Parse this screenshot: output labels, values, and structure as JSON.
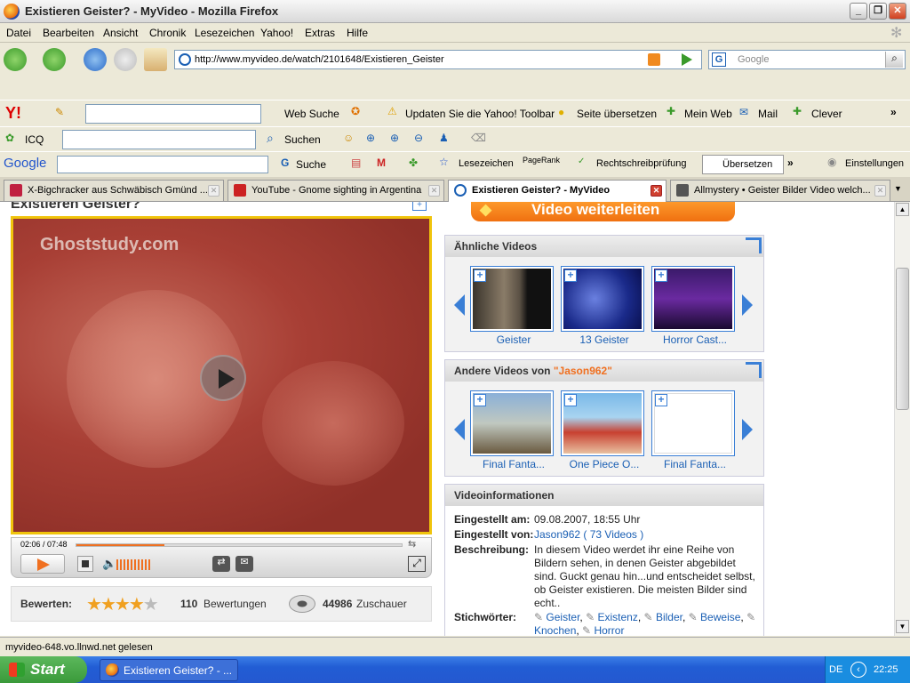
{
  "window": {
    "title": "Existieren Geister? - MyVideo - Mozilla Firefox"
  },
  "menu": [
    "Datei",
    "Bearbeiten",
    "Ansicht",
    "Chronik",
    "Lesezeichen",
    "Yahoo!",
    "Extras",
    "Hilfe"
  ],
  "nav": {
    "url": "http://www.myvideo.de/watch/2101648/Existieren_Geister",
    "search_placeholder": "Google"
  },
  "yahoo_toolbar": {
    "web_search": "Web Suche",
    "update": "Updaten Sie die Yahoo! Toolbar",
    "translate": "Seite übersetzen",
    "my_web": "Mein Web",
    "mail": "Mail",
    "clever": "Clever"
  },
  "icq_toolbar": {
    "label": "ICQ",
    "search": "Suchen"
  },
  "google_toolbar": {
    "search": "Suche",
    "bookmarks": "Lesezeichen",
    "pagerank": "PageRank",
    "spell": "Rechtschreibprüfung",
    "translate": "Übersetzen",
    "settings": "Einstellungen"
  },
  "tabs": [
    {
      "label": "X-Bigchracker aus Schwäbisch Gmünd ...",
      "color": "#c02040"
    },
    {
      "label": "YouTube - Gnome sighting in Argentina",
      "color": "#cc2222"
    },
    {
      "label": "Existieren Geister? - MyVideo",
      "color": "#1a5fb4"
    },
    {
      "label": "Allmystery • Geister Bilder Video welch...",
      "color": "#555555"
    }
  ],
  "page": {
    "video_title": "Existieren Geister?",
    "watermark": "Ghoststudy.com",
    "time": "02:06 / 07:48",
    "progress": 0.27,
    "forward_button": "Video weiterleiten",
    "rating_label": "Bewerten:",
    "rating_stars": 4,
    "rating_count": "110",
    "rating_word": "Bewertungen",
    "views": "44986",
    "views_word": "Zuschauer",
    "similar_title": "Ähnliche Videos",
    "similar": [
      "Geister",
      "13 Geister",
      "Horror Cast..."
    ],
    "other_title_prefix": "Andere Videos von",
    "other_user": "\"Jason962\"",
    "other": [
      "Final Fanta...",
      "One Piece O...",
      "Final Fanta..."
    ],
    "info_title": "Videoinformationen",
    "info_date_label": "Eingestellt am:",
    "info_date": "09.08.2007, 18:55 Uhr",
    "info_by_label": "Eingestellt von:",
    "info_by_user": "Jason962",
    "info_by_count": "( 73 Videos )",
    "info_desc_label": "Beschreibung:",
    "info_desc": "In diesem Video werdet ihr eine Reihe von Bildern sehen, in denen Geister abgebildet sind. Guckt genau hin...und entscheidet selbst, ob Geister existieren. Die meisten Bilder sind echt..",
    "info_tags_label": "Stichwörter:",
    "info_tags": [
      "Geister",
      "Existenz",
      "Bilder",
      "Beweise",
      "Knochen",
      "Horror"
    ]
  },
  "status": "myvideo-648.vo.llnwd.net gelesen",
  "taskbar": {
    "start": "Start",
    "item": "Existieren Geister? - ...",
    "lang": "DE",
    "clock": "22:25"
  }
}
